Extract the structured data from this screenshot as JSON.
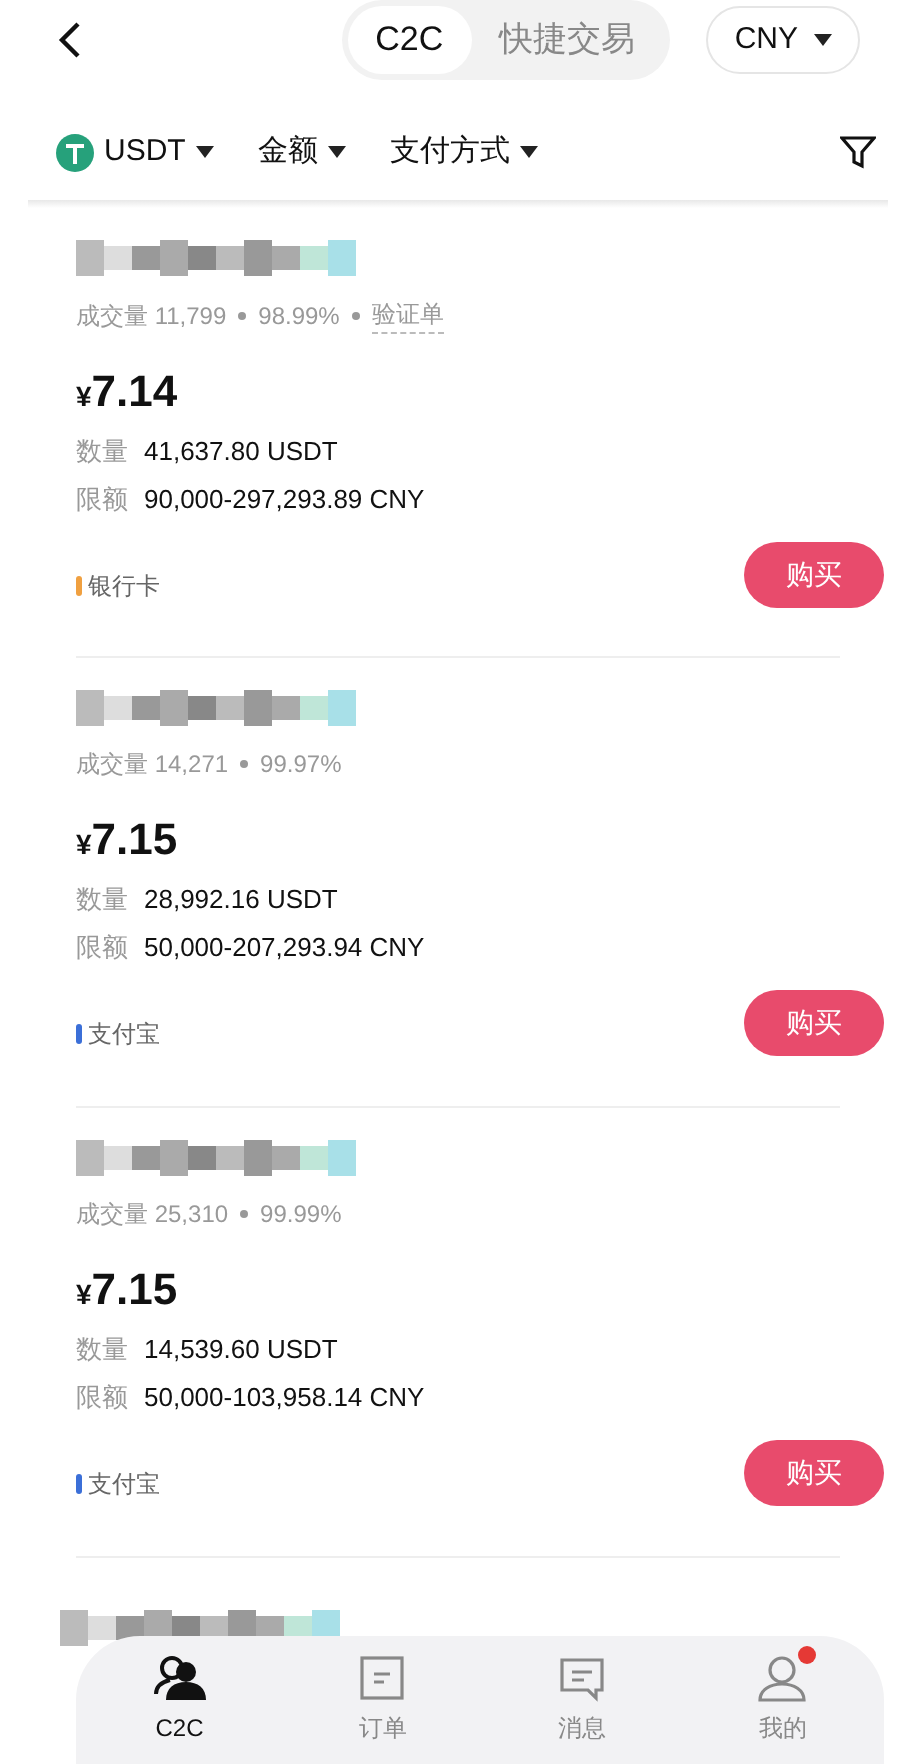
{
  "header": {
    "tabs": [
      {
        "label": "C2C",
        "selected": true
      },
      {
        "label": "快捷交易",
        "selected": false
      }
    ],
    "currency": "CNY"
  },
  "filters": [
    {
      "label": "USDT",
      "kind": "coin"
    },
    {
      "label": "金额",
      "kind": "plain"
    },
    {
      "label": "支付方式",
      "kind": "plain"
    }
  ],
  "offers": [
    {
      "stats": [
        "成交量 11,799",
        "98.99%"
      ],
      "verified": "验证单",
      "price_symbol": "¥",
      "price": "7.14",
      "quantity_label": "数量",
      "quantity": "41,637.80 USDT",
      "limit_label": "限额",
      "limit": "90,000-297,293.89 CNY",
      "payment": "银行卡",
      "color": "#f0a040",
      "action": "购买"
    },
    {
      "stats": [
        "成交量 14,271",
        "99.97%"
      ],
      "price_symbol": "¥",
      "price": "7.15",
      "quantity_label": "数量",
      "quantity": "28,992.16 USDT",
      "limit_label": "限额",
      "limit": "50,000-207,293.94 CNY",
      "payment": "支付宝",
      "color": "#3b6fd8",
      "action": "购买"
    },
    {
      "stats": [
        "成交量 25,310",
        "99.99%"
      ],
      "price_symbol": "¥",
      "price": "7.15",
      "quantity_label": "数量",
      "quantity": "14,539.60 USDT",
      "limit_label": "限额",
      "limit": "50,000-103,958.14 CNY",
      "payment": "支付宝",
      "color": "#3b6fd8",
      "action": "购买"
    }
  ],
  "nav": [
    {
      "label": "C2C",
      "kind": "people",
      "selected": true,
      "badge": false
    },
    {
      "label": "订单",
      "kind": "order",
      "selected": false,
      "badge": false
    },
    {
      "label": "消息",
      "kind": "message",
      "selected": false,
      "badge": false
    },
    {
      "label": "我的",
      "kind": "user",
      "selected": false,
      "badge": true
    }
  ]
}
